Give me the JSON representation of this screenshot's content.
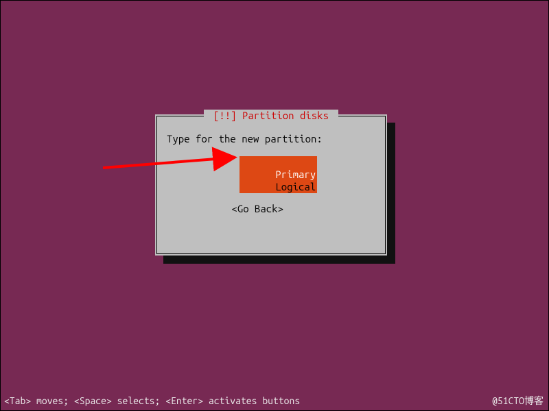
{
  "dialog": {
    "title": "[!!] Partition disks",
    "prompt": "Type for the new partition:",
    "options": [
      "Primary",
      "Logical"
    ],
    "selected_index": 0,
    "go_back": "<Go Back>"
  },
  "help_line": "<Tab> moves; <Space> selects; <Enter> activates buttons",
  "watermark": "@51CTO博客",
  "colors": {
    "background": "#772953",
    "dialog_bg": "#bfbfbf",
    "title_fg": "#c00",
    "highlight_bg": "#dd4814",
    "highlight_fg": "#ffffff",
    "arrow": "#ff0000"
  }
}
